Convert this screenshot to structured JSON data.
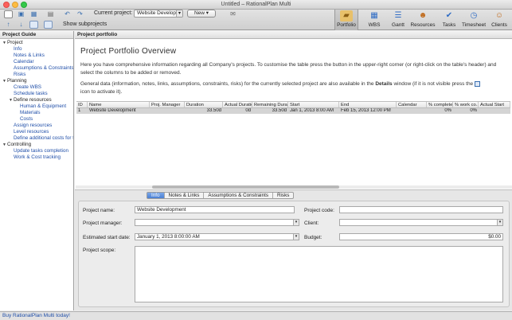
{
  "window": {
    "title": "Untitled – RationalPlan Multi"
  },
  "toolbar": {
    "current_project_label": "Current project:",
    "current_project_value": "Website Developn",
    "new_label": "New",
    "show_subprojects_label": "Show subprojects",
    "icons": [
      "new-file-icon",
      "open-folder-icon",
      "save-icon",
      "print-icon",
      "undo-icon",
      "redo-icon",
      "arrow-up-icon",
      "arrow-down-icon",
      "outdent-icon",
      "indent-icon",
      "mail-icon"
    ]
  },
  "nav": [
    {
      "label": "Portfolio",
      "icon": "portfolio-icon",
      "active": true
    },
    {
      "label": "WBS",
      "icon": "wbs-icon",
      "active": false
    },
    {
      "label": "Gantt",
      "icon": "gantt-icon",
      "active": false
    },
    {
      "label": "Resources",
      "icon": "resources-icon",
      "active": false
    },
    {
      "label": "Tasks",
      "icon": "tasks-icon",
      "active": false
    },
    {
      "label": "Timesheet",
      "icon": "timesheet-icon",
      "active": false
    },
    {
      "label": "Clients",
      "icon": "clients-icon",
      "active": false
    }
  ],
  "guide": {
    "title": "Project Guide",
    "items": [
      {
        "label": "Project",
        "level": 0,
        "group": true
      },
      {
        "label": "Info",
        "level": 1,
        "group": false
      },
      {
        "label": "Notes & Links",
        "level": 1,
        "group": false
      },
      {
        "label": "Calendar",
        "level": 1,
        "group": false
      },
      {
        "label": "Assumptions & Constraints",
        "level": 1,
        "group": false
      },
      {
        "label": "Risks",
        "level": 1,
        "group": false
      },
      {
        "label": "Planning",
        "level": 0,
        "group": true
      },
      {
        "label": "Create WBS",
        "level": 1,
        "group": false
      },
      {
        "label": "Schedule tasks",
        "level": 1,
        "group": false
      },
      {
        "label": "Define resources",
        "level": 1,
        "group": true
      },
      {
        "label": "Human & Equipment",
        "level": 2,
        "group": false
      },
      {
        "label": "Materials",
        "level": 2,
        "group": false
      },
      {
        "label": "Costs",
        "level": 2,
        "group": false
      },
      {
        "label": "Assign resources",
        "level": 1,
        "group": false
      },
      {
        "label": "Level resources",
        "level": 1,
        "group": false
      },
      {
        "label": "Define additional costs for tasks",
        "level": 1,
        "group": false
      },
      {
        "label": "Controlling",
        "level": 0,
        "group": true
      },
      {
        "label": "Update tasks completion",
        "level": 1,
        "group": false
      },
      {
        "label": "Work & Cost tracking",
        "level": 1,
        "group": false
      }
    ]
  },
  "portfolio": {
    "title": "Project portfolio",
    "heading": "Project Portfolio Overview",
    "para1_l1": "Here you have comprehensive information regarding all Company's projects. To customise the table press the button in the upper-right corner (or right-click on the table's header) and",
    "para1_l2": "select the columns to be added or removed.",
    "para2_l1_a": "General data (information, notes, links, assumptions, constraints, risks) for the currently selected project are also available in the",
    "para2_l1_b": "Details",
    "para2_l1_c": "window (if it is not visible press the",
    "para2_l2": "icon to activate it)."
  },
  "table": {
    "columns": [
      "ID",
      "Name",
      "Proj. Manager",
      "Duration",
      "Actual Duration",
      "Remaining Duration",
      "Start",
      "End",
      "Calendar",
      "% complete",
      "% work co...",
      "Actual Start"
    ],
    "rows": [
      [
        "1",
        "Website Development",
        "",
        "33.50d",
        "0d",
        "33.50d",
        "Jan 1, 2013 8:00 AM",
        "Feb 15, 2013 12:00 PM",
        "",
        "0%",
        "0%",
        ""
      ]
    ]
  },
  "details": {
    "tabs": [
      "Info",
      "Notes & Links",
      "Assumptions & Constraints",
      "Risks"
    ],
    "active_tab": "Info",
    "project_name_label": "Project name:",
    "project_name_value": "Website Development",
    "project_code_label": "Project code:",
    "project_code_value": "",
    "project_manager_label": "Project manager:",
    "project_manager_value": "",
    "client_label": "Client:",
    "client_value": "",
    "est_start_label": "Estimated start date:",
    "est_start_value": "January 1, 2013 8:00:00 AM",
    "budget_label": "Budget:",
    "budget_value": "$0.00",
    "scope_label": "Project scope:",
    "scope_value": ""
  },
  "status": {
    "text": "Buy RationalPlan Multi today!"
  },
  "colors": {
    "accent": "#4a7fd3",
    "link": "#1f4ea8",
    "selected_row": "#d4d4d4"
  }
}
